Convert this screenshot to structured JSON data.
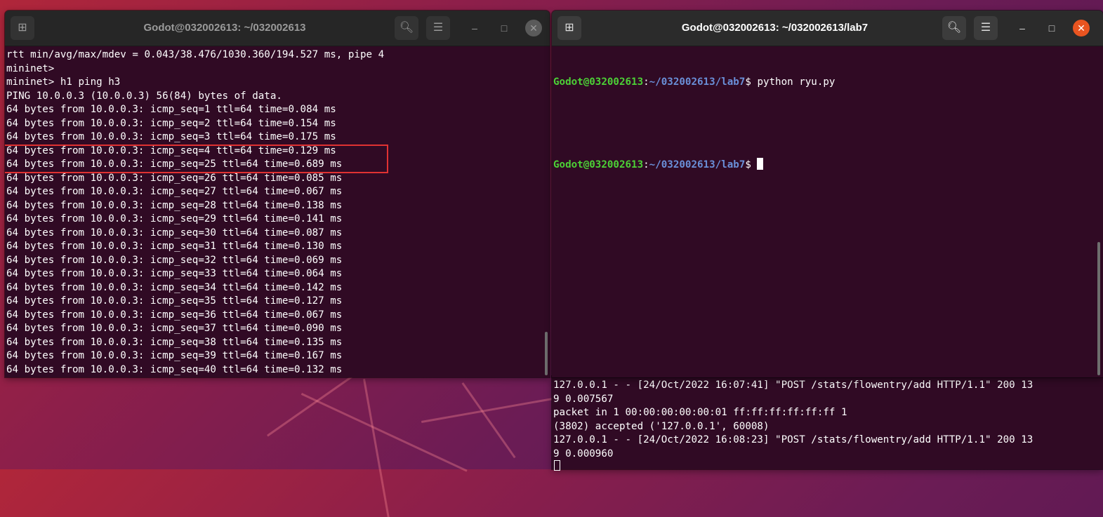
{
  "left_window": {
    "title": "Godot@032002613: ~/032002613",
    "new_tab_icon": "new-tab-icon",
    "lines": [
      "rtt min/avg/max/mdev = 0.043/38.476/1030.360/194.527 ms, pipe 4",
      "mininet>",
      "mininet> h1 ping h3",
      "PING 10.0.0.3 (10.0.0.3) 56(84) bytes of data.",
      "64 bytes from 10.0.0.3: icmp_seq=1 ttl=64 time=0.084 ms",
      "64 bytes from 10.0.0.3: icmp_seq=2 ttl=64 time=0.154 ms",
      "64 bytes from 10.0.0.3: icmp_seq=3 ttl=64 time=0.175 ms",
      "64 bytes from 10.0.0.3: icmp_seq=4 ttl=64 time=0.129 ms",
      "64 bytes from 10.0.0.3: icmp_seq=25 ttl=64 time=0.689 ms",
      "64 bytes from 10.0.0.3: icmp_seq=26 ttl=64 time=0.085 ms",
      "64 bytes from 10.0.0.3: icmp_seq=27 ttl=64 time=0.067 ms",
      "64 bytes from 10.0.0.3: icmp_seq=28 ttl=64 time=0.138 ms",
      "64 bytes from 10.0.0.3: icmp_seq=29 ttl=64 time=0.141 ms",
      "64 bytes from 10.0.0.3: icmp_seq=30 ttl=64 time=0.087 ms",
      "64 bytes from 10.0.0.3: icmp_seq=31 ttl=64 time=0.130 ms",
      "64 bytes from 10.0.0.3: icmp_seq=32 ttl=64 time=0.069 ms",
      "64 bytes from 10.0.0.3: icmp_seq=33 ttl=64 time=0.064 ms",
      "64 bytes from 10.0.0.3: icmp_seq=34 ttl=64 time=0.142 ms",
      "64 bytes from 10.0.0.3: icmp_seq=35 ttl=64 time=0.127 ms",
      "64 bytes from 10.0.0.3: icmp_seq=36 ttl=64 time=0.067 ms",
      "64 bytes from 10.0.0.3: icmp_seq=37 ttl=64 time=0.090 ms",
      "64 bytes from 10.0.0.3: icmp_seq=38 ttl=64 time=0.135 ms",
      "64 bytes from 10.0.0.3: icmp_seq=39 ttl=64 time=0.167 ms",
      "64 bytes from 10.0.0.3: icmp_seq=40 ttl=64 time=0.132 ms"
    ]
  },
  "right_window": {
    "title": "Godot@032002613: ~/032002613/lab7",
    "prompt_user": "Godot@032002613",
    "prompt_sep": ":",
    "prompt_path": "~/032002613/lab7",
    "prompt_dollar": "$ ",
    "command1": "python ryu.py"
  },
  "background_terminal": {
    "lines": [
      "127.0.0.1 - - [24/Oct/2022 16:07:41] \"POST /stats/flowentry/add HTTP/1.1\" 200 13",
      "9 0.007567",
      "packet in 1 00:00:00:00:00:01 ff:ff:ff:ff:ff:ff 1",
      "(3802) accepted ('127.0.0.1', 60008)",
      "127.0.0.1 - - [24/Oct/2022 16:08:23] \"POST /stats/flowentry/add HTTP/1.1\" 200 13",
      "9 0.000960"
    ]
  },
  "colors": {
    "terminal_bg": "#300a24",
    "prompt_user": "#4cd136",
    "prompt_path": "#6a8fd8",
    "highlight_box": "#e03232",
    "close_active": "#e95420"
  }
}
